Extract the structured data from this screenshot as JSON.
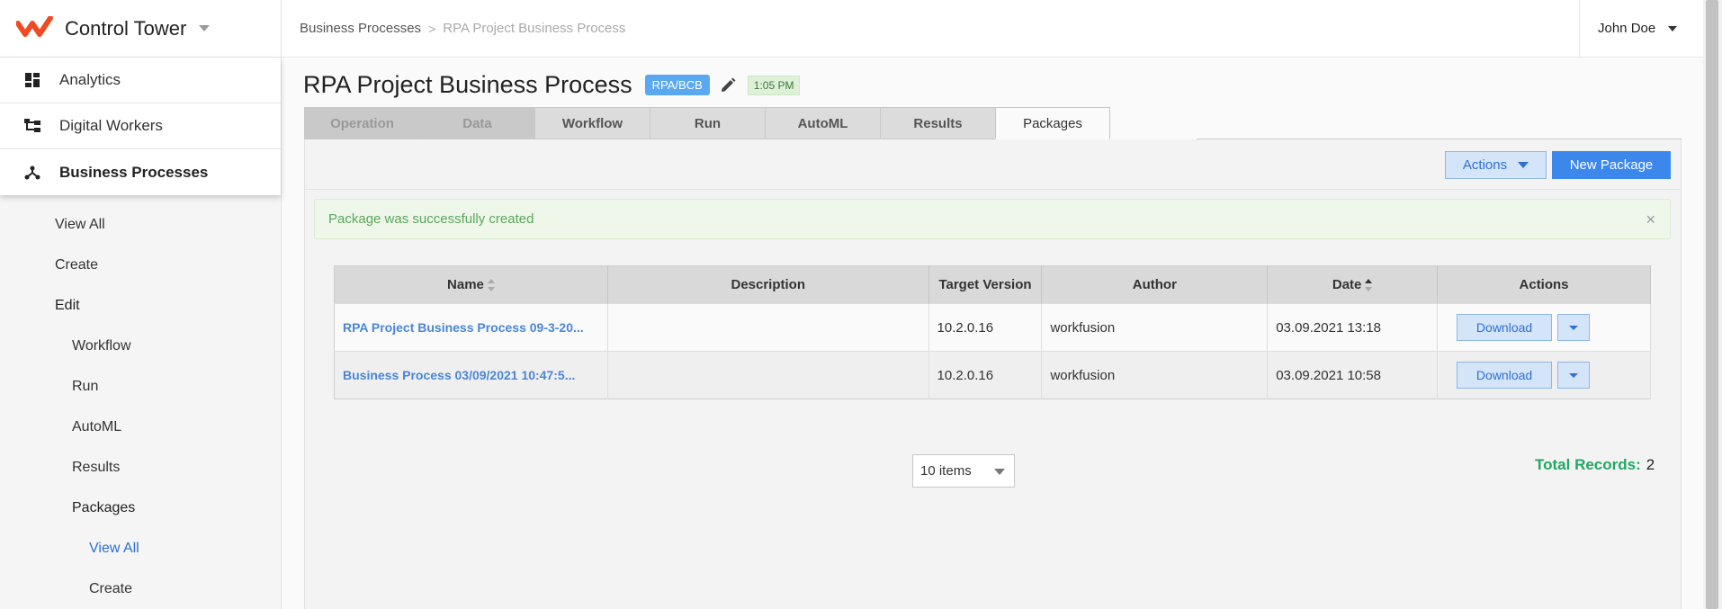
{
  "app": {
    "title": "Control Tower",
    "accent": "#f04a22",
    "link": "#4a86d8"
  },
  "nav": {
    "items": [
      {
        "label": "Analytics",
        "icon": "dashboard-icon"
      },
      {
        "label": "Digital Workers",
        "icon": "hierarchy-icon"
      },
      {
        "label": "Business Processes",
        "icon": "process-icon"
      }
    ],
    "sub": {
      "view_all": "View All",
      "create": "Create",
      "edit": "Edit",
      "workflow": "Workflow",
      "run": "Run",
      "automl": "AutoML",
      "results": "Results",
      "packages": "Packages",
      "pkg_view_all": "View All",
      "pkg_create": "Create"
    }
  },
  "breadcrumb": {
    "parent": "Business Processes",
    "sep": ">",
    "current": "RPA Project Business Process"
  },
  "user": {
    "name": "John Doe"
  },
  "page": {
    "title": "RPA Project Business Process",
    "badge": "RPA/BCB",
    "time": "1:05 PM"
  },
  "tabs": [
    "Operation",
    "Data",
    "Workflow",
    "Run",
    "AutoML",
    "Results",
    "Packages"
  ],
  "toolbar": {
    "actions_label": "Actions",
    "new_label": "New Package"
  },
  "alert": {
    "message": "Package was successfully created",
    "close": "×"
  },
  "table": {
    "headers": {
      "name": "Name",
      "description": "Description",
      "target": "Target Version",
      "author": "Author",
      "date": "Date",
      "actions": "Actions"
    },
    "rows": [
      {
        "name": "RPA Project Business Process 09-3-20...",
        "description": "",
        "target": "10.2.0.16",
        "author": "workfusion",
        "date": "03.09.2021 13:18",
        "action": "Download"
      },
      {
        "name": "Business Process 03/09/2021 10:47:5...",
        "description": "",
        "target": "10.2.0.16",
        "author": "workfusion",
        "date": "03.09.2021 10:58",
        "action": "Download"
      }
    ]
  },
  "pager": {
    "size": "10 items"
  },
  "total": {
    "label": "Total Records:",
    "value": "2"
  }
}
